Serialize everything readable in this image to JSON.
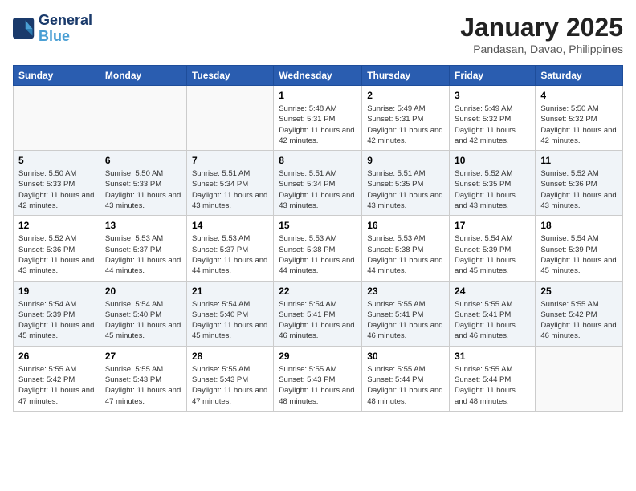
{
  "header": {
    "logo_line1": "General",
    "logo_line2": "Blue",
    "month": "January 2025",
    "location": "Pandasan, Davao, Philippines"
  },
  "weekdays": [
    "Sunday",
    "Monday",
    "Tuesday",
    "Wednesday",
    "Thursday",
    "Friday",
    "Saturday"
  ],
  "weeks": [
    [
      {
        "day": "",
        "info": ""
      },
      {
        "day": "",
        "info": ""
      },
      {
        "day": "",
        "info": ""
      },
      {
        "day": "1",
        "sunrise": "5:48 AM",
        "sunset": "5:31 PM",
        "daylight": "11 hours and 42 minutes."
      },
      {
        "day": "2",
        "sunrise": "5:49 AM",
        "sunset": "5:31 PM",
        "daylight": "11 hours and 42 minutes."
      },
      {
        "day": "3",
        "sunrise": "5:49 AM",
        "sunset": "5:32 PM",
        "daylight": "11 hours and 42 minutes."
      },
      {
        "day": "4",
        "sunrise": "5:50 AM",
        "sunset": "5:32 PM",
        "daylight": "11 hours and 42 minutes."
      }
    ],
    [
      {
        "day": "5",
        "sunrise": "5:50 AM",
        "sunset": "5:33 PM",
        "daylight": "11 hours and 42 minutes."
      },
      {
        "day": "6",
        "sunrise": "5:50 AM",
        "sunset": "5:33 PM",
        "daylight": "11 hours and 43 minutes."
      },
      {
        "day": "7",
        "sunrise": "5:51 AM",
        "sunset": "5:34 PM",
        "daylight": "11 hours and 43 minutes."
      },
      {
        "day": "8",
        "sunrise": "5:51 AM",
        "sunset": "5:34 PM",
        "daylight": "11 hours and 43 minutes."
      },
      {
        "day": "9",
        "sunrise": "5:51 AM",
        "sunset": "5:35 PM",
        "daylight": "11 hours and 43 minutes."
      },
      {
        "day": "10",
        "sunrise": "5:52 AM",
        "sunset": "5:35 PM",
        "daylight": "11 hours and 43 minutes."
      },
      {
        "day": "11",
        "sunrise": "5:52 AM",
        "sunset": "5:36 PM",
        "daylight": "11 hours and 43 minutes."
      }
    ],
    [
      {
        "day": "12",
        "sunrise": "5:52 AM",
        "sunset": "5:36 PM",
        "daylight": "11 hours and 43 minutes."
      },
      {
        "day": "13",
        "sunrise": "5:53 AM",
        "sunset": "5:37 PM",
        "daylight": "11 hours and 44 minutes."
      },
      {
        "day": "14",
        "sunrise": "5:53 AM",
        "sunset": "5:37 PM",
        "daylight": "11 hours and 44 minutes."
      },
      {
        "day": "15",
        "sunrise": "5:53 AM",
        "sunset": "5:38 PM",
        "daylight": "11 hours and 44 minutes."
      },
      {
        "day": "16",
        "sunrise": "5:53 AM",
        "sunset": "5:38 PM",
        "daylight": "11 hours and 44 minutes."
      },
      {
        "day": "17",
        "sunrise": "5:54 AM",
        "sunset": "5:39 PM",
        "daylight": "11 hours and 45 minutes."
      },
      {
        "day": "18",
        "sunrise": "5:54 AM",
        "sunset": "5:39 PM",
        "daylight": "11 hours and 45 minutes."
      }
    ],
    [
      {
        "day": "19",
        "sunrise": "5:54 AM",
        "sunset": "5:39 PM",
        "daylight": "11 hours and 45 minutes."
      },
      {
        "day": "20",
        "sunrise": "5:54 AM",
        "sunset": "5:40 PM",
        "daylight": "11 hours and 45 minutes."
      },
      {
        "day": "21",
        "sunrise": "5:54 AM",
        "sunset": "5:40 PM",
        "daylight": "11 hours and 45 minutes."
      },
      {
        "day": "22",
        "sunrise": "5:54 AM",
        "sunset": "5:41 PM",
        "daylight": "11 hours and 46 minutes."
      },
      {
        "day": "23",
        "sunrise": "5:55 AM",
        "sunset": "5:41 PM",
        "daylight": "11 hours and 46 minutes."
      },
      {
        "day": "24",
        "sunrise": "5:55 AM",
        "sunset": "5:41 PM",
        "daylight": "11 hours and 46 minutes."
      },
      {
        "day": "25",
        "sunrise": "5:55 AM",
        "sunset": "5:42 PM",
        "daylight": "11 hours and 46 minutes."
      }
    ],
    [
      {
        "day": "26",
        "sunrise": "5:55 AM",
        "sunset": "5:42 PM",
        "daylight": "11 hours and 47 minutes."
      },
      {
        "day": "27",
        "sunrise": "5:55 AM",
        "sunset": "5:43 PM",
        "daylight": "11 hours and 47 minutes."
      },
      {
        "day": "28",
        "sunrise": "5:55 AM",
        "sunset": "5:43 PM",
        "daylight": "11 hours and 47 minutes."
      },
      {
        "day": "29",
        "sunrise": "5:55 AM",
        "sunset": "5:43 PM",
        "daylight": "11 hours and 48 minutes."
      },
      {
        "day": "30",
        "sunrise": "5:55 AM",
        "sunset": "5:44 PM",
        "daylight": "11 hours and 48 minutes."
      },
      {
        "day": "31",
        "sunrise": "5:55 AM",
        "sunset": "5:44 PM",
        "daylight": "11 hours and 48 minutes."
      },
      {
        "day": "",
        "info": ""
      }
    ]
  ]
}
